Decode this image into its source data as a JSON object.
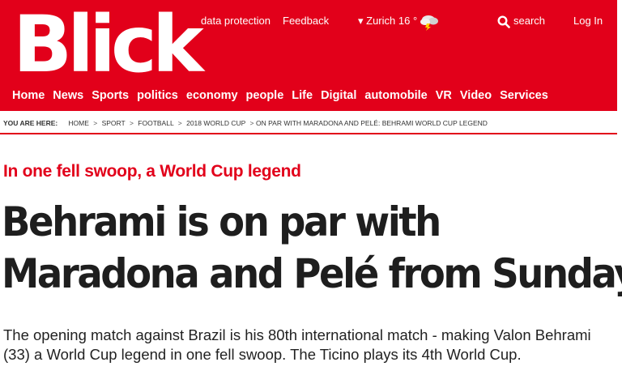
{
  "header": {
    "logo": "Blick",
    "top_links": {
      "data_protection": "data protection",
      "feedback": "Feedback",
      "weather": "▾ Zurich 16 °",
      "search": "search",
      "login": "Log In"
    },
    "nav": [
      "Home",
      "News",
      "Sports",
      "politics",
      "economy",
      "people",
      "Life",
      "Digital",
      "automobile",
      "VR",
      "Video",
      "Services"
    ]
  },
  "breadcrumb": {
    "label": "YOU ARE HERE:",
    "items": [
      "HOME",
      "SPORT",
      "FOOTBALL",
      "2018 WORLD CUP"
    ],
    "current": "ON PAR WITH MARADONA AND PELÉ: BEHRAMI WORLD CUP LEGEND"
  },
  "article": {
    "kicker": "In one fell swoop, a World Cup legend",
    "headline_line1": "Behrami is on par with",
    "headline_line2": "Maradona and Pelé from Sunday",
    "lead": "The opening match against Brazil is his 80th international match - making Valon Behrami (33) a World Cup legend in one fell swoop. The Ticino plays its 4th World Cup."
  },
  "colors": {
    "brand": "#e2001a",
    "text": "#222222"
  },
  "icons": {
    "weather": "cloud-lightning-icon",
    "search": "search-icon"
  }
}
